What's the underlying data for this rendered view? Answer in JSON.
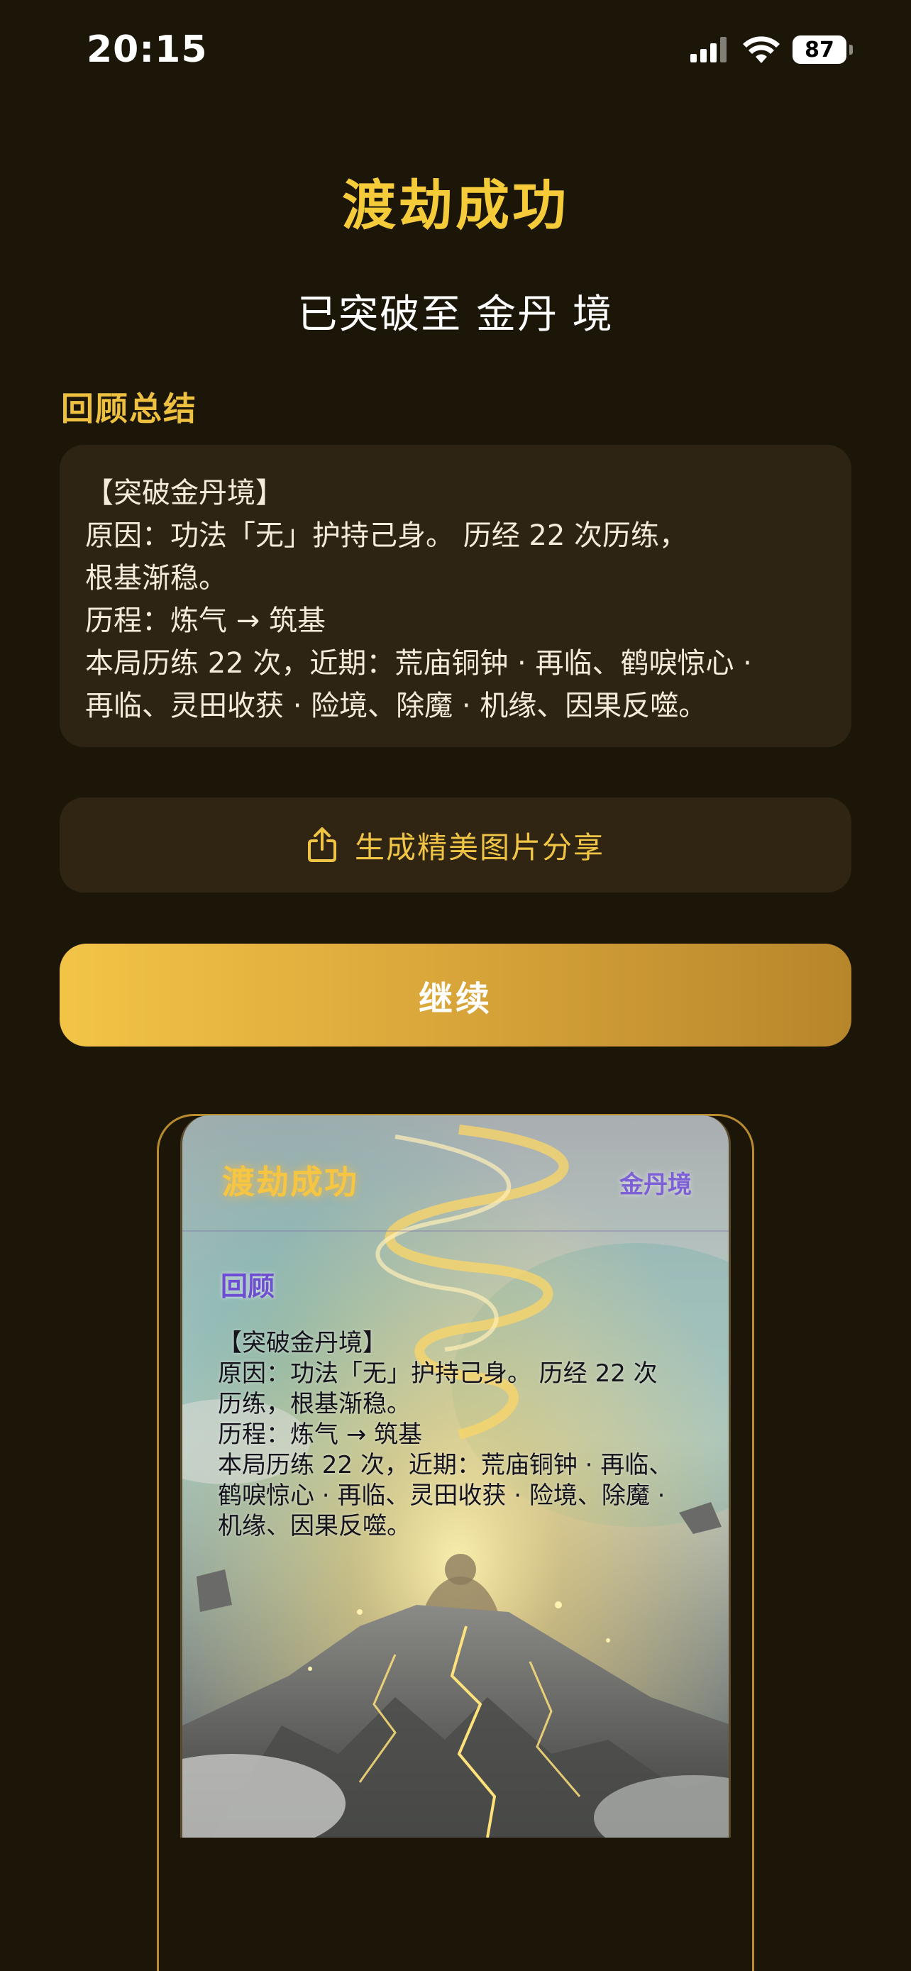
{
  "status_bar": {
    "time": "20:15",
    "battery": "87",
    "signal_icon": "cellular-signal-icon",
    "wifi_icon": "wifi-icon"
  },
  "header": {
    "title": "渡劫成功",
    "subtitle": "已突破至 金丹 境"
  },
  "summary": {
    "section_title": "回顾总结",
    "lines": [
      "【突破金丹境】",
      "原因：功法「无」护持己身。 历经 22 次历练，",
      "根基渐稳。",
      "历程：炼气 → 筑基",
      "本局历练 22 次，近期：荒庙铜钟 · 再临、鹤唳惊心 ·",
      "再临、灵田收获 · 险境、除魔 · 机缘、因果反噬。"
    ]
  },
  "actions": {
    "share_label": "生成精美图片分享",
    "share_icon": "share-icon",
    "continue_label": "继续"
  },
  "preview": {
    "title": "渡劫成功",
    "realm": "金丹境",
    "section_title": "回顾",
    "lines": [
      "【突破金丹境】",
      "原因：功法「无」护持己身。 历经 22 次",
      "历练，根基渐稳。",
      "历程：炼气 → 筑基",
      "本局历练 22 次，近期：荒庙铜钟 · 再临、",
      "鹤唳惊心 · 再临、灵田收获 · 险境、除魔 ·",
      "机缘、因果反噬。"
    ]
  },
  "colors": {
    "background": "#1c1609",
    "accent_gold": "#f5cb3a",
    "card_bg": "#2e2413",
    "preview_realm": "#7d5fd6"
  }
}
